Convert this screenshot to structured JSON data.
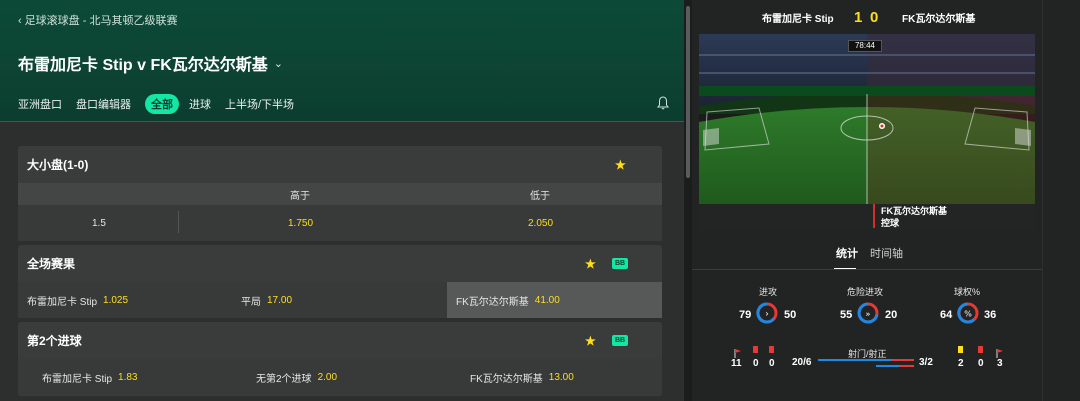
{
  "breadcrumb": "足球滚球盘 - 北马其顿乙级联赛",
  "match_title": "布雷加尼卡 Stip v FK瓦尔达尔斯基",
  "tabs": [
    "亚洲盘口",
    "盘口编辑器",
    "全部",
    "进球",
    "上半场/下半场"
  ],
  "active_tab": "全部",
  "markets": {
    "total": {
      "title": "大小盘(1-0)",
      "col_over": "高于",
      "col_under": "低于",
      "line": "1.5",
      "over": "1.750",
      "under": "2.050"
    },
    "fulltime": {
      "title": "全场赛果",
      "badge": "BB",
      "home_name": "布雷加尼卡 Stip",
      "home_odd": "1.025",
      "draw_name": "平局",
      "draw_odd": "17.00",
      "away_name": "FK瓦尔达尔斯基",
      "away_odd": "41.00"
    },
    "second_goal": {
      "title": "第2个进球",
      "badge": "BB",
      "home_name": "布雷加尼卡 Stip",
      "home_odd": "1.83",
      "none_name": "无第2个进球",
      "none_odd": "2.00",
      "away_name": "FK瓦尔达尔斯基",
      "away_odd": "13.00"
    }
  },
  "scoreboard": {
    "home": "布雷加尼卡 Stip",
    "home_score": "1",
    "away_score": "0",
    "away": "FK瓦尔达尔斯基"
  },
  "pitch": {
    "clock": "78:44",
    "possession_team": "FK瓦尔达尔斯基",
    "possession_state": "控球"
  },
  "stats_tabs": [
    "统计",
    "时间轴"
  ],
  "stats": {
    "attacks": {
      "label": "进攻",
      "home": "79",
      "away": "50"
    },
    "dangerous": {
      "label": "危险进攻",
      "home": "55",
      "away": "20"
    },
    "possession": {
      "label": "球权%",
      "home": "64",
      "away": "36"
    },
    "shots": {
      "label": "射门/射正",
      "home": "20/6",
      "away": "3/2"
    },
    "home_cards": {
      "corners": "11",
      "yellow": "0",
      "red": "0"
    },
    "away_cards": {
      "yellow": "2",
      "red": "0",
      "corners": "3"
    }
  },
  "colors": {
    "accent": "#14e6a3",
    "odds": "#ffdf1b",
    "header_green": "#0c4a37",
    "home_blue": "#1e88e5",
    "away_red": "#e53935"
  }
}
